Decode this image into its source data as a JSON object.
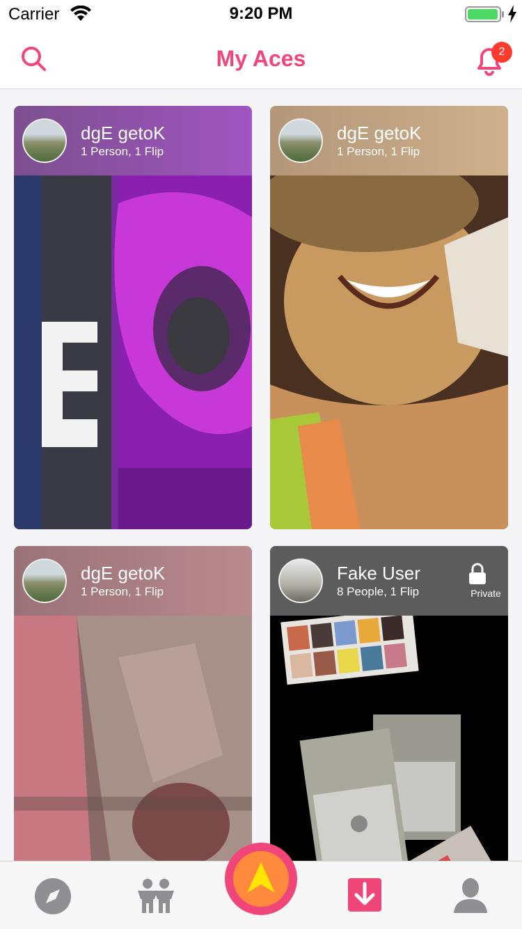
{
  "status_bar": {
    "carrier": "Carrier",
    "time": "9:20 PM"
  },
  "nav": {
    "title": "My Aces",
    "notification_count": "2"
  },
  "cards": [
    {
      "name": "dgE getoK",
      "subtitle": "1 Person, 1 Flip",
      "header_color": "#9b4bb0",
      "private": false
    },
    {
      "name": "dgE getoK",
      "subtitle": "1 Person, 1 Flip",
      "header_color": "#b89a7a",
      "private": false
    },
    {
      "name": "dgE getoK",
      "subtitle": "1 Person, 1 Flip",
      "header_color": "#a8787e",
      "private": false
    },
    {
      "name": "Fake User",
      "subtitle": "8 People, 1 Flip",
      "header_color": "#5a5a5a",
      "private": true,
      "private_label": "Private"
    }
  ],
  "tab_bar": {
    "items": [
      "compass-icon",
      "people-icon",
      "ace-icon",
      "download-icon",
      "profile-icon"
    ],
    "accent": "#f0467a"
  },
  "colors": {
    "accent": "#f0467a",
    "battery": "#4cd964",
    "badge": "#ff3b30"
  }
}
